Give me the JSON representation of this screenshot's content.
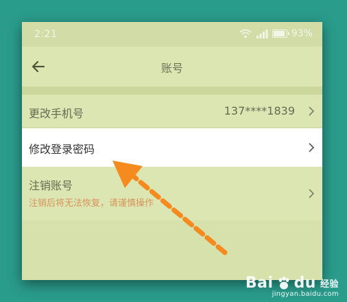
{
  "status_bar": {
    "time": "2:21",
    "battery": "93%",
    "battery_level": 0.93
  },
  "header": {
    "title": "账号"
  },
  "settings": {
    "rows": [
      {
        "label": "更改手机号",
        "value": "137****1839"
      },
      {
        "label": "修改登录密码"
      },
      {
        "label": "注销账号",
        "warning": "注销后将无法恢复，请谨慎操作"
      }
    ]
  },
  "annotation": {
    "arrow_color": "#f58a1f"
  },
  "watermark": {
    "brand": "Bai",
    "brand_suffix": "du",
    "product": "经验",
    "url": "jingyan.baidu.com"
  },
  "colors": {
    "background": "#2a9c8c",
    "screen": "#d9e4b1",
    "highlight_row": "#ffffff",
    "warning_text": "#d9935a"
  }
}
